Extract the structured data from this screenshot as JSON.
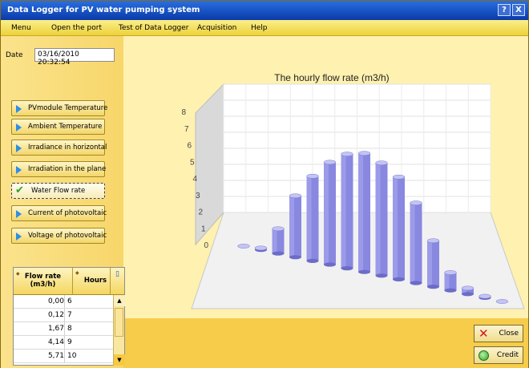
{
  "window": {
    "title": "Data Logger for PV water pumping system",
    "help_btn": "?",
    "close_btn": "X"
  },
  "menu": [
    "Menu",
    "Open the port",
    "Test of Data Logger",
    "Acquisition",
    "Help"
  ],
  "date": {
    "label": "Date",
    "value": "03/16/2010 20:32:54"
  },
  "side_buttons": [
    {
      "label": "PVmodule Temperature",
      "active": false
    },
    {
      "label": "Ambient Temperature",
      "active": false
    },
    {
      "label": "Irradiance in horizontal",
      "active": false
    },
    {
      "label": "Irradiation in the plane",
      "active": false
    },
    {
      "label": "Water Flow rate",
      "active": true
    },
    {
      "label": "Current of photovoltaic",
      "active": false
    },
    {
      "label": "Voltage of photovoltaic",
      "active": false
    }
  ],
  "table": {
    "col_flow": "Flow rate (m3/h)",
    "col_hours": "Hours",
    "rows": [
      {
        "flow": "0,00",
        "hours": "6"
      },
      {
        "flow": "0,12",
        "hours": "7"
      },
      {
        "flow": "1,67",
        "hours": "8"
      },
      {
        "flow": "4,14",
        "hours": "9"
      },
      {
        "flow": "5,71",
        "hours": "10"
      }
    ]
  },
  "buttons": {
    "close": "Close",
    "credit": "Credit"
  },
  "chart_data": {
    "type": "bar",
    "title": "The hourly flow rate (m3/h)",
    "y_ticks": [
      "0",
      "1",
      "2",
      "3",
      "4",
      "5",
      "6",
      "7",
      "8"
    ],
    "ylim": [
      0,
      8
    ],
    "grid": true,
    "values": [
      0.0,
      0.12,
      1.67,
      4.14,
      5.71,
      6.9,
      7.7,
      8.0,
      7.6,
      6.9,
      5.4,
      3.1,
      1.2,
      0.4,
      0.1,
      0.0
    ],
    "bar_color": "#8888e0"
  }
}
